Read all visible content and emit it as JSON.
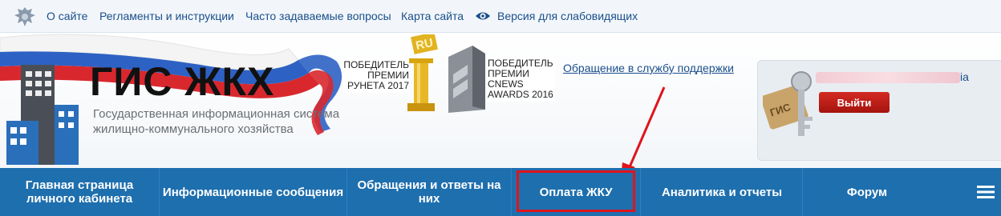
{
  "topbar": {
    "links": [
      {
        "label": "О сайте"
      },
      {
        "label": "Регламенты и инструкции"
      },
      {
        "label": "Часто задаваемые вопросы"
      },
      {
        "label": "Карта сайта"
      },
      {
        "label": "Версия для слабовидящих"
      }
    ]
  },
  "logo": {
    "title": "ГИС ЖКХ",
    "subtitle": "Государственная информационная система жилищно-коммунального хозяйства"
  },
  "awards": [
    {
      "text": "ПОБЕДИТЕЛЬ ПРЕМИИ РУНЕТА 2017",
      "badge": "RU"
    },
    {
      "text": "ПОБЕДИТЕЛЬ ПРЕМИИ CNEWS AWARDS 2016"
    }
  ],
  "support": {
    "label": "Обращение в службу поддержки"
  },
  "user": {
    "name_suffix": "ia",
    "logout_label": "Выйти"
  },
  "nav": {
    "items": [
      {
        "label": "Главная страница личного кабинета"
      },
      {
        "label": "Информационные сообщения"
      },
      {
        "label": "Обращения и ответы на них"
      },
      {
        "label": "Оплата ЖКУ"
      },
      {
        "label": "Аналитика и отчеты"
      },
      {
        "label": "Форум"
      }
    ],
    "active_index": 3
  },
  "colors": {
    "nav_bg": "#1e6fae",
    "link": "#1a4f8c",
    "logout_bg": "#c3201a",
    "highlight": "#e0141c"
  }
}
